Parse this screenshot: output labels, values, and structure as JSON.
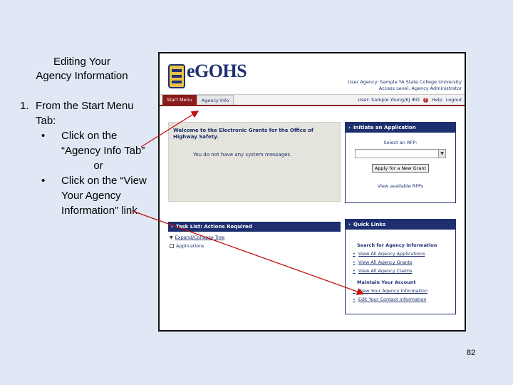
{
  "slide": {
    "title_line1": "Editing Your",
    "title_line2": "Agency Information",
    "step_number": "1.",
    "step_text": "From the Start Menu Tab:",
    "bullet1": "Click on the “Agency Info Tab”",
    "or": "or",
    "bullet2": "Click on the “View Your Agency Information” link.",
    "page_number": "82"
  },
  "app": {
    "logo_text": "eGOHS",
    "user_agency": "User Agency: Sample YA State College University",
    "access_level": "Access Level: Agency Administrator",
    "user": "User: Sample Young/KJ IRD",
    "help": "Help",
    "logout": "Logout"
  },
  "tabs": [
    {
      "label": "Start Menu",
      "active": true
    },
    {
      "label": "Agency Info",
      "active": false
    }
  ],
  "welcome": {
    "title": "Welcome to the Electronic Grants for the Office of Highway Safety.",
    "message": "You do not have any system messages."
  },
  "initiate": {
    "heading": "Initiate an Application",
    "select_label": "Select an RFP:",
    "apply_button": "Apply for a New Grant",
    "view_rfps": "View available RFPs"
  },
  "tasklist": {
    "heading": "Task List: Actions Required",
    "expand": "Expand/Collapse Tree",
    "item": "Applications"
  },
  "quicklinks": {
    "heading": "Quick Links",
    "search_heading": "Search for Agency Information",
    "search_links": [
      "View All Agency Applications",
      "View All Agency Grants",
      "View All Agency Claims"
    ],
    "maintain_heading": "Maintain Your Account",
    "maintain_links": [
      "View Your Agency Information",
      "Edit Your Contact Information"
    ]
  },
  "colors": {
    "navy": "#1d2f6e",
    "maroon": "#8a1c1c",
    "arrow": "#c01010",
    "slide_bg": "#dfe8f4"
  }
}
